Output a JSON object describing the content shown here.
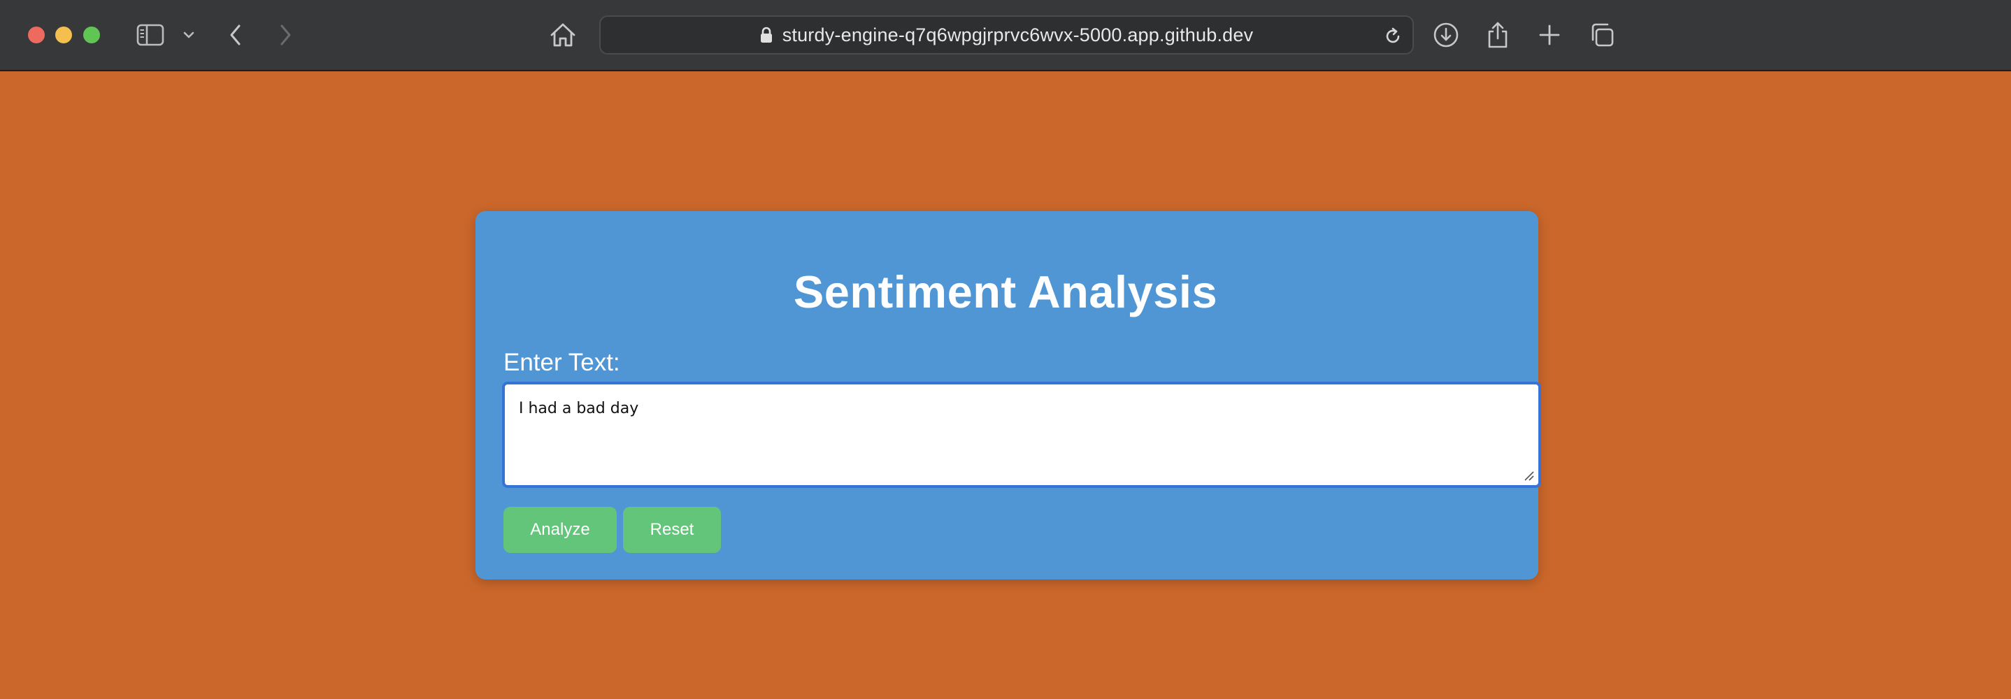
{
  "browser": {
    "url": "sturdy-engine-q7q6wpgjrprvc6wvx-5000.app.github.dev",
    "icons": {
      "window_controls": [
        "close-dot",
        "minimize-dot",
        "zoom-dot"
      ],
      "left": [
        "sidebar-icon",
        "chevron-down-icon",
        "back-icon",
        "forward-icon"
      ],
      "address": [
        "home-icon",
        "lock-icon",
        "reload-icon"
      ],
      "right": [
        "download-icon",
        "share-icon",
        "plus-icon",
        "tabs-overview-icon"
      ]
    }
  },
  "page": {
    "background_color": "#cb672b",
    "card_color": "#5196d4",
    "title": "Sentiment Analysis",
    "input_label": "Enter Text:",
    "input_value": "I had a bad day",
    "buttons": {
      "analyze": "Analyze",
      "reset": "Reset"
    },
    "button_color": "#63c57a"
  }
}
